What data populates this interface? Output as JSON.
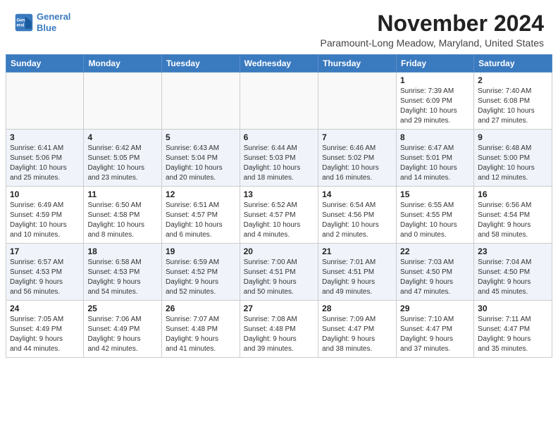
{
  "header": {
    "logo_line1": "General",
    "logo_line2": "Blue",
    "month": "November 2024",
    "location": "Paramount-Long Meadow, Maryland, United States"
  },
  "days_of_week": [
    "Sunday",
    "Monday",
    "Tuesday",
    "Wednesday",
    "Thursday",
    "Friday",
    "Saturday"
  ],
  "weeks": [
    [
      {
        "day": "",
        "info": ""
      },
      {
        "day": "",
        "info": ""
      },
      {
        "day": "",
        "info": ""
      },
      {
        "day": "",
        "info": ""
      },
      {
        "day": "",
        "info": ""
      },
      {
        "day": "1",
        "info": "Sunrise: 7:39 AM\nSunset: 6:09 PM\nDaylight: 10 hours\nand 29 minutes."
      },
      {
        "day": "2",
        "info": "Sunrise: 7:40 AM\nSunset: 6:08 PM\nDaylight: 10 hours\nand 27 minutes."
      }
    ],
    [
      {
        "day": "3",
        "info": "Sunrise: 6:41 AM\nSunset: 5:06 PM\nDaylight: 10 hours\nand 25 minutes."
      },
      {
        "day": "4",
        "info": "Sunrise: 6:42 AM\nSunset: 5:05 PM\nDaylight: 10 hours\nand 23 minutes."
      },
      {
        "day": "5",
        "info": "Sunrise: 6:43 AM\nSunset: 5:04 PM\nDaylight: 10 hours\nand 20 minutes."
      },
      {
        "day": "6",
        "info": "Sunrise: 6:44 AM\nSunset: 5:03 PM\nDaylight: 10 hours\nand 18 minutes."
      },
      {
        "day": "7",
        "info": "Sunrise: 6:46 AM\nSunset: 5:02 PM\nDaylight: 10 hours\nand 16 minutes."
      },
      {
        "day": "8",
        "info": "Sunrise: 6:47 AM\nSunset: 5:01 PM\nDaylight: 10 hours\nand 14 minutes."
      },
      {
        "day": "9",
        "info": "Sunrise: 6:48 AM\nSunset: 5:00 PM\nDaylight: 10 hours\nand 12 minutes."
      }
    ],
    [
      {
        "day": "10",
        "info": "Sunrise: 6:49 AM\nSunset: 4:59 PM\nDaylight: 10 hours\nand 10 minutes."
      },
      {
        "day": "11",
        "info": "Sunrise: 6:50 AM\nSunset: 4:58 PM\nDaylight: 10 hours\nand 8 minutes."
      },
      {
        "day": "12",
        "info": "Sunrise: 6:51 AM\nSunset: 4:57 PM\nDaylight: 10 hours\nand 6 minutes."
      },
      {
        "day": "13",
        "info": "Sunrise: 6:52 AM\nSunset: 4:57 PM\nDaylight: 10 hours\nand 4 minutes."
      },
      {
        "day": "14",
        "info": "Sunrise: 6:54 AM\nSunset: 4:56 PM\nDaylight: 10 hours\nand 2 minutes."
      },
      {
        "day": "15",
        "info": "Sunrise: 6:55 AM\nSunset: 4:55 PM\nDaylight: 10 hours\nand 0 minutes."
      },
      {
        "day": "16",
        "info": "Sunrise: 6:56 AM\nSunset: 4:54 PM\nDaylight: 9 hours\nand 58 minutes."
      }
    ],
    [
      {
        "day": "17",
        "info": "Sunrise: 6:57 AM\nSunset: 4:53 PM\nDaylight: 9 hours\nand 56 minutes."
      },
      {
        "day": "18",
        "info": "Sunrise: 6:58 AM\nSunset: 4:53 PM\nDaylight: 9 hours\nand 54 minutes."
      },
      {
        "day": "19",
        "info": "Sunrise: 6:59 AM\nSunset: 4:52 PM\nDaylight: 9 hours\nand 52 minutes."
      },
      {
        "day": "20",
        "info": "Sunrise: 7:00 AM\nSunset: 4:51 PM\nDaylight: 9 hours\nand 50 minutes."
      },
      {
        "day": "21",
        "info": "Sunrise: 7:01 AM\nSunset: 4:51 PM\nDaylight: 9 hours\nand 49 minutes."
      },
      {
        "day": "22",
        "info": "Sunrise: 7:03 AM\nSunset: 4:50 PM\nDaylight: 9 hours\nand 47 minutes."
      },
      {
        "day": "23",
        "info": "Sunrise: 7:04 AM\nSunset: 4:50 PM\nDaylight: 9 hours\nand 45 minutes."
      }
    ],
    [
      {
        "day": "24",
        "info": "Sunrise: 7:05 AM\nSunset: 4:49 PM\nDaylight: 9 hours\nand 44 minutes."
      },
      {
        "day": "25",
        "info": "Sunrise: 7:06 AM\nSunset: 4:49 PM\nDaylight: 9 hours\nand 42 minutes."
      },
      {
        "day": "26",
        "info": "Sunrise: 7:07 AM\nSunset: 4:48 PM\nDaylight: 9 hours\nand 41 minutes."
      },
      {
        "day": "27",
        "info": "Sunrise: 7:08 AM\nSunset: 4:48 PM\nDaylight: 9 hours\nand 39 minutes."
      },
      {
        "day": "28",
        "info": "Sunrise: 7:09 AM\nSunset: 4:47 PM\nDaylight: 9 hours\nand 38 minutes."
      },
      {
        "day": "29",
        "info": "Sunrise: 7:10 AM\nSunset: 4:47 PM\nDaylight: 9 hours\nand 37 minutes."
      },
      {
        "day": "30",
        "info": "Sunrise: 7:11 AM\nSunset: 4:47 PM\nDaylight: 9 hours\nand 35 minutes."
      }
    ]
  ]
}
